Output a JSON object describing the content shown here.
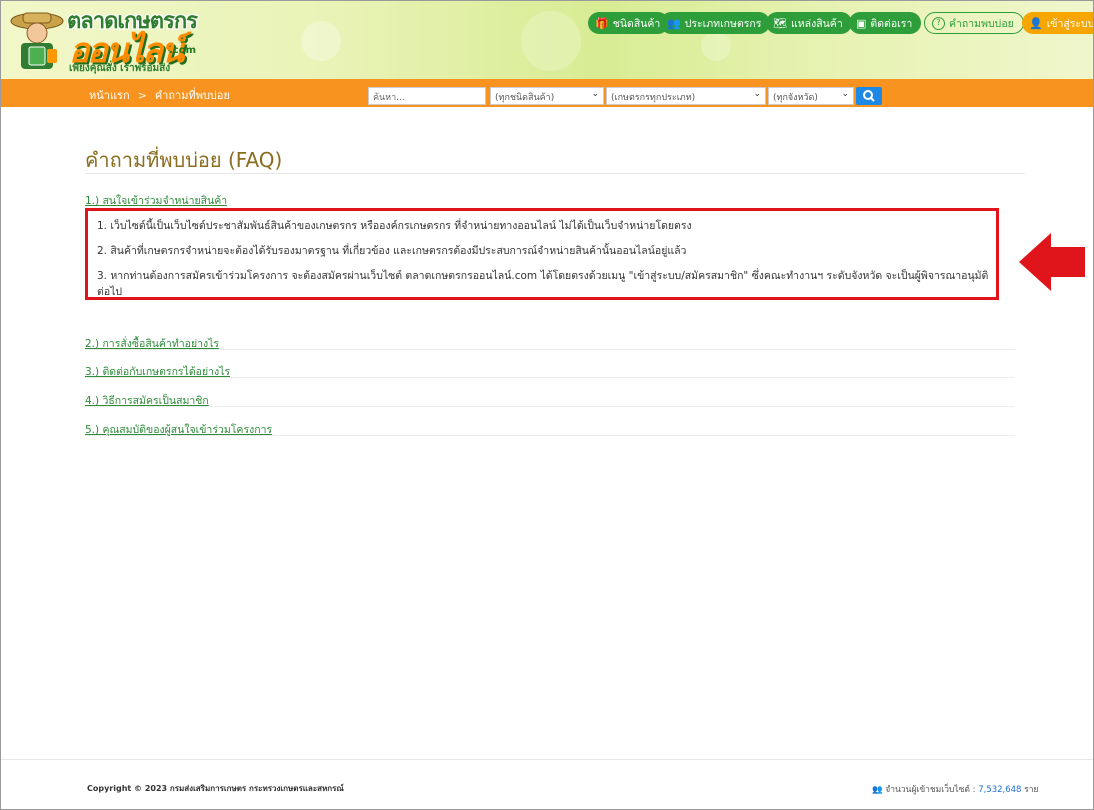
{
  "header": {
    "logo_title": "ตลาดเกษตรกร",
    "logo_big": "ออนไลน์",
    "logo_dotcom": ".com",
    "logo_slogan": "เพียงคุณสั่ง เราพร้อมส่ง"
  },
  "topnav": [
    {
      "icon": "gift-icon",
      "glyph": "🎁",
      "label": "ชนิดสินค้า"
    },
    {
      "icon": "people-icon",
      "glyph": "👥",
      "label": "ประเภทเกษตรกร"
    },
    {
      "icon": "map-icon",
      "glyph": "🗺",
      "label": "แหล่งสินค้า"
    },
    {
      "icon": "contact-icon",
      "glyph": "▣",
      "label": "ติดต่อเรา"
    },
    {
      "icon": "question-icon",
      "glyph": "?",
      "label": "คำถามพบบ่อย"
    },
    {
      "icon": "user-icon",
      "glyph": "👤",
      "label": "เข้าสู่ระบบ"
    }
  ],
  "breadcrumb": {
    "home": "หน้าแรก",
    "separator": ">",
    "current": "คำถามที่พบบ่อย"
  },
  "search": {
    "placeholder": "ค้นหา...",
    "product_type": "(ทุกชนิดสินค้า)",
    "farmer_type": "(เกษตรกรทุกประเภท)",
    "province": "(ทุกจังหวัด)"
  },
  "faq": {
    "title": "คำถามที่พบบ่อย (FAQ)",
    "questions": [
      "1.) สนใจเข้าร่วมจำหน่ายสินค้า",
      "2.) การสั่งซื้อสินค้าทำอย่างไร",
      "3.) ติดต่อกับเกษตรกรได้อย่างไร",
      "4.) วิธีการสมัครเป็นสมาชิก",
      "5.) คุณสมบัติของผู้สนใจเข้าร่วมโครงการ"
    ],
    "answers": [
      "1. เว็บไซต์นี้เป็นเว็บไซต์ประชาสัมพันธ์สินค้าของเกษตรกร หรือองค์กรเกษตรกร ที่จำหน่ายทางออนไลน์ ไม่ได้เป็นเว็บจำหน่ายโดยตรง",
      "2. สินค้าที่เกษตรกรจำหน่ายจะต้องได้รับรองมาตรฐาน ที่เกี่ยวข้อง และเกษตรกรต้องมีประสบการณ์จำหน่ายสินค้านั้นออนไลน์อยู่แล้ว",
      "3. หากท่านต้องการสมัครเข้าร่วมโครงการ จะต้องสมัครผ่านเว็บไซต์ ตลาดเกษตรกรออนไลน์.com ได้โดยตรงด้วยเมนู \"เข้าสู่ระบบ/สมัครสมาชิก\" ซึ่งคณะทำงานฯ ระดับจังหวัด จะเป็นผู้พิจารณาอนุมัติ",
      "ต่อไป"
    ]
  },
  "footer": {
    "copyright": "Copyright © 2023 กรมส่งเสริมการเกษตร กระทรวงเกษตรและสหกรณ์",
    "visitors_label": "จำนวนผู้เข้าชมเว็บไซต์ :",
    "visitors_count": "7,532,648",
    "visitors_unit": "ราย"
  },
  "colors": {
    "orange_bar": "#f7931e",
    "green": "#2e9e3a",
    "highlight_red": "#e0141b",
    "title": "#8a6d1e"
  }
}
